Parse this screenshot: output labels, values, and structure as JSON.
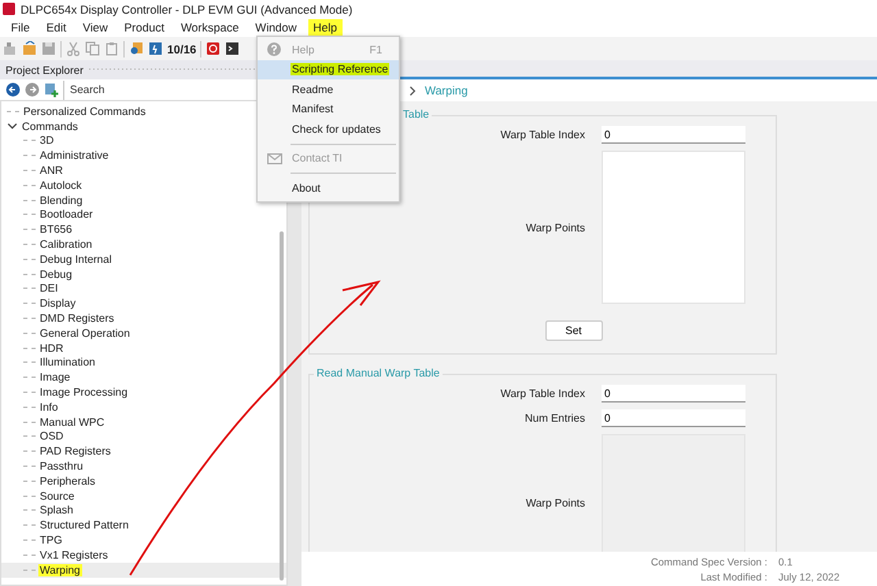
{
  "window": {
    "title": "DLPC654x Display Controller - DLP EVM GUI (Advanced Mode)"
  },
  "menu_bar": [
    {
      "label": "File",
      "highlighted": false
    },
    {
      "label": "Edit",
      "highlighted": false
    },
    {
      "label": "View",
      "highlighted": false
    },
    {
      "label": "Product",
      "highlighted": false
    },
    {
      "label": "Workspace",
      "highlighted": false
    },
    {
      "label": "Window",
      "highlighted": false
    },
    {
      "label": "Help",
      "highlighted": true
    }
  ],
  "toolbar": {
    "counter": "10/16"
  },
  "project_explorer": {
    "title": "Project Explorer",
    "search": {
      "placeholder": "Search"
    },
    "tree": [
      {
        "label": "Personalized Commands",
        "selected": false,
        "highlighted": false
      },
      {
        "label": "Commands",
        "selected": false,
        "highlighted": false,
        "expanded": true,
        "children": [
          {
            "label": "3D",
            "selected": false,
            "highlighted": false
          },
          {
            "label": "Administrative",
            "selected": false,
            "highlighted": false
          },
          {
            "label": "ANR",
            "selected": false,
            "highlighted": false
          },
          {
            "label": "Autolock",
            "selected": false,
            "highlighted": false
          },
          {
            "label": "Blending",
            "selected": false,
            "highlighted": false
          },
          {
            "label": "Bootloader",
            "selected": false,
            "highlighted": false
          },
          {
            "label": "BT656",
            "selected": false,
            "highlighted": false
          },
          {
            "label": "Calibration",
            "selected": false,
            "highlighted": false
          },
          {
            "label": "Debug Internal",
            "selected": false,
            "highlighted": false
          },
          {
            "label": "Debug",
            "selected": false,
            "highlighted": false
          },
          {
            "label": "DEI",
            "selected": false,
            "highlighted": false
          },
          {
            "label": "Display",
            "selected": false,
            "highlighted": false
          },
          {
            "label": "DMD Registers",
            "selected": false,
            "highlighted": false
          },
          {
            "label": "General Operation",
            "selected": false,
            "highlighted": false
          },
          {
            "label": "HDR",
            "selected": false,
            "highlighted": false
          },
          {
            "label": "Illumination",
            "selected": false,
            "highlighted": false
          },
          {
            "label": "Image",
            "selected": false,
            "highlighted": false
          },
          {
            "label": "Image Processing",
            "selected": false,
            "highlighted": false
          },
          {
            "label": "Info",
            "selected": false,
            "highlighted": false
          },
          {
            "label": "Manual WPC",
            "selected": false,
            "highlighted": false
          },
          {
            "label": "OSD",
            "selected": false,
            "highlighted": false
          },
          {
            "label": "PAD Registers",
            "selected": false,
            "highlighted": false
          },
          {
            "label": "Passthru",
            "selected": false,
            "highlighted": false
          },
          {
            "label": "Peripherals",
            "selected": false,
            "highlighted": false
          },
          {
            "label": "Source",
            "selected": false,
            "highlighted": false
          },
          {
            "label": "Splash",
            "selected": false,
            "highlighted": false
          },
          {
            "label": "Structured Pattern",
            "selected": false,
            "highlighted": false
          },
          {
            "label": "TPG",
            "selected": false,
            "highlighted": false
          },
          {
            "label": "Vx1 Registers",
            "selected": false,
            "highlighted": false
          },
          {
            "label": "Warping",
            "selected": true,
            "highlighted": true
          }
        ]
      }
    ]
  },
  "breadcrumb": {
    "current": "Warping"
  },
  "groups": [
    {
      "legend": "Table",
      "fields": [
        {
          "kind": "input",
          "label": "Warp Table Index",
          "value": "0"
        },
        {
          "kind": "textarea",
          "label": "Warp Points",
          "disabled": false
        }
      ],
      "button": "Set"
    },
    {
      "legend": "Read Manual Warp Table",
      "fields": [
        {
          "kind": "input",
          "label": "Warp Table Index",
          "value": "0"
        },
        {
          "kind": "input",
          "label": "Num Entries",
          "value": "0"
        },
        {
          "kind": "textarea",
          "label": "Warp Points",
          "disabled": true
        }
      ]
    }
  ],
  "footer": [
    {
      "label": "Command Spec Version :",
      "value": "0.1"
    },
    {
      "label": "Last Modified :",
      "value": "July 12, 2022"
    }
  ],
  "help_menu": {
    "items": [
      {
        "kind": "help",
        "label": "Help",
        "shortcut": "F1",
        "disabled": true,
        "selected": false,
        "highlighted": false
      },
      {
        "kind": "item",
        "label": "Scripting Reference",
        "disabled": false,
        "selected": true,
        "highlighted": true
      },
      {
        "kind": "item",
        "label": "Readme",
        "disabled": false,
        "selected": false,
        "highlighted": false
      },
      {
        "kind": "item",
        "label": "Manifest",
        "disabled": false,
        "selected": false,
        "highlighted": false
      },
      {
        "kind": "item",
        "label": "Check for updates",
        "disabled": false,
        "selected": false,
        "highlighted": false
      },
      {
        "kind": "separator"
      },
      {
        "kind": "mail",
        "label": "Contact TI",
        "disabled": true,
        "selected": false,
        "highlighted": false
      },
      {
        "kind": "separator"
      },
      {
        "kind": "item",
        "label": "About",
        "disabled": false,
        "selected": false,
        "highlighted": false
      }
    ]
  }
}
